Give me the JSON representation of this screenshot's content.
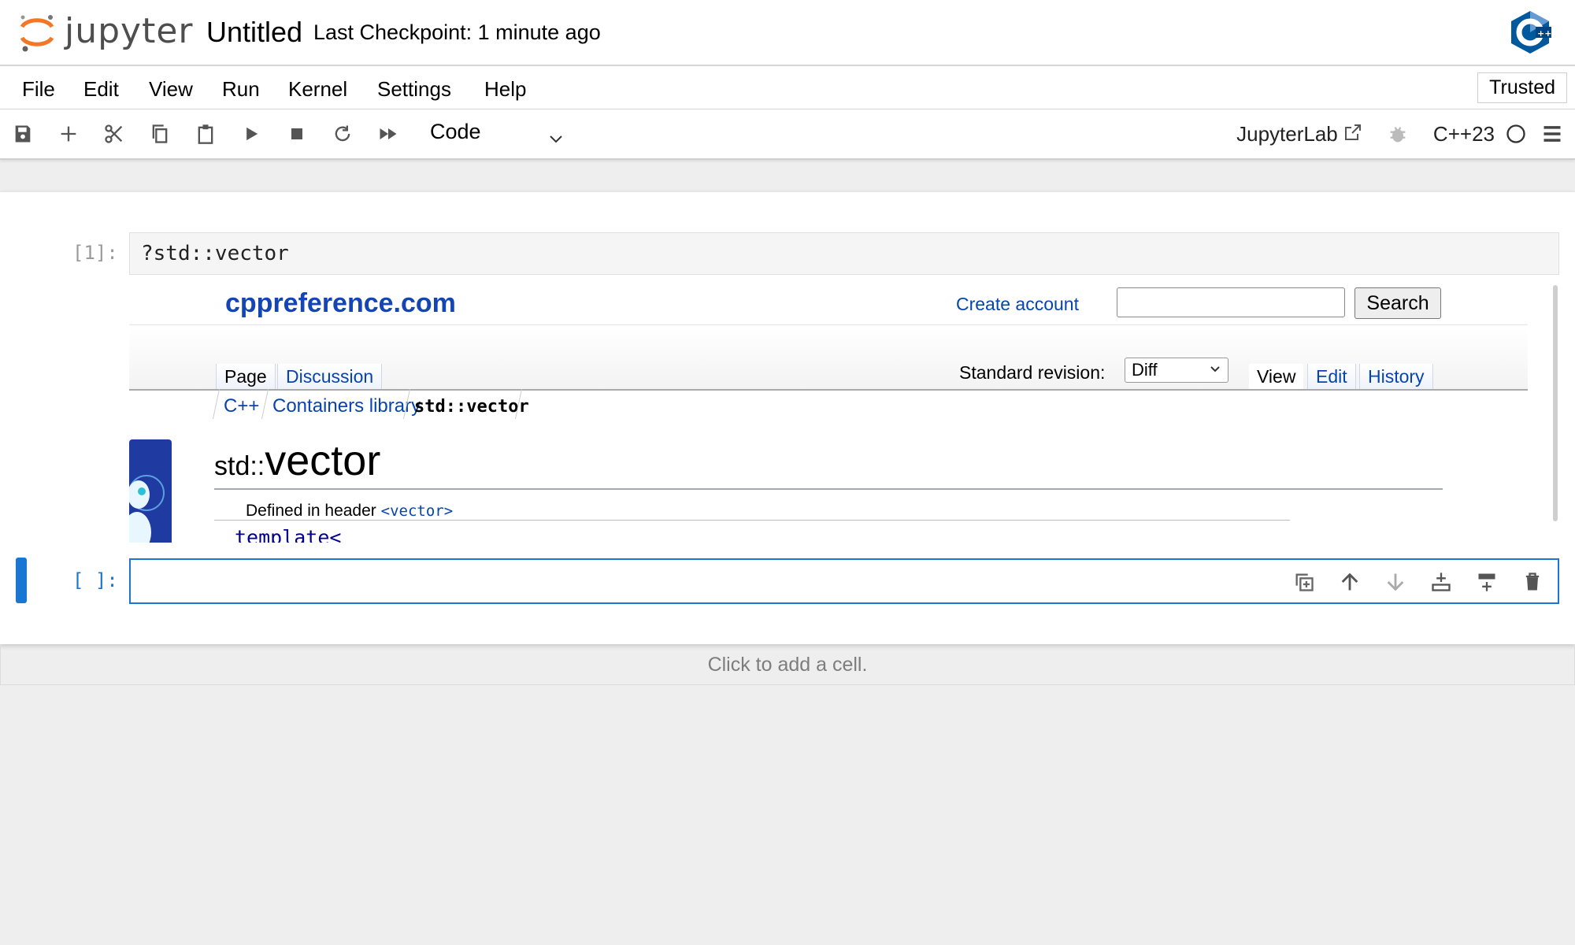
{
  "header": {
    "logo_text": "jupyter",
    "notebook_title": "Untitled",
    "checkpoint": "Last Checkpoint: 1 minute ago",
    "kernel_logo_icon": "cpp-logo-icon"
  },
  "menu": {
    "items": [
      "File",
      "Edit",
      "View",
      "Run",
      "Kernel",
      "Settings",
      "Help"
    ],
    "trusted": "Trusted"
  },
  "toolbar": {
    "icons": [
      "save-icon",
      "plus-icon",
      "scissors-icon",
      "copy-icon",
      "paste-icon",
      "run-icon",
      "stop-icon",
      "restart-icon",
      "fast-forward-icon"
    ],
    "cell_type": "Code",
    "jupyterlab_label": "JupyterLab",
    "kernel_name": "C++23",
    "kernel_status": "idle"
  },
  "cells": [
    {
      "prompt": "[1]:",
      "source": "?std::vector",
      "output": {
        "site_name": "cppreference.com",
        "create_account": "Create account",
        "search_button": "Search",
        "search_value": "",
        "tabs_left": [
          "Page",
          "Discussion"
        ],
        "standard_revision_label": "Standard revision:",
        "standard_revision_value": "Diff",
        "tabs_right": [
          "View",
          "Edit",
          "History"
        ],
        "breadcrumb": [
          "C++",
          "Containers library",
          "std::vector"
        ],
        "heading_prefix": "std::",
        "heading_name": "vector",
        "defined_in_label": "Defined in header",
        "defined_in_header": "<vector>",
        "template_keyword": "template<"
      }
    },
    {
      "prompt": "[ ]:",
      "source": "",
      "tools": [
        "duplicate-icon",
        "move-up-icon",
        "move-down-icon",
        "insert-below-icon",
        "insert-above-icon",
        "delete-icon"
      ]
    }
  ],
  "footer": {
    "add_cell": "Click to add a cell."
  },
  "colors": {
    "accent": "#1976d2",
    "jupyter_orange": "#f37726",
    "link_blue": "#0645ad"
  }
}
